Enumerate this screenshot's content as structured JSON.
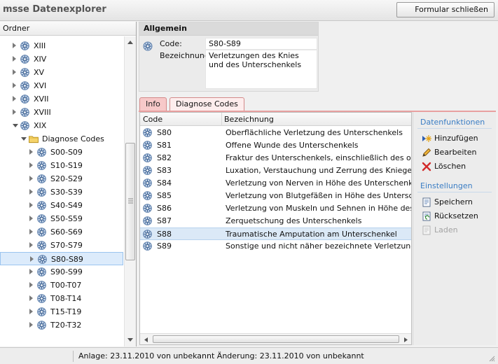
{
  "app": {
    "title": "msse Datenexplorer",
    "close_form_label": "Formular schließen"
  },
  "tree": {
    "header": "Ordner",
    "items": [
      {
        "label": "XIII",
        "level": 1,
        "expanded": false,
        "selected": false,
        "kind": "node"
      },
      {
        "label": "XIV",
        "level": 1,
        "expanded": false,
        "selected": false,
        "kind": "node"
      },
      {
        "label": "XV",
        "level": 1,
        "expanded": false,
        "selected": false,
        "kind": "node"
      },
      {
        "label": "XVI",
        "level": 1,
        "expanded": false,
        "selected": false,
        "kind": "node"
      },
      {
        "label": "XVII",
        "level": 1,
        "expanded": false,
        "selected": false,
        "kind": "node"
      },
      {
        "label": "XVIII",
        "level": 1,
        "expanded": false,
        "selected": false,
        "kind": "node"
      },
      {
        "label": "XIX",
        "level": 1,
        "expanded": true,
        "selected": false,
        "kind": "node"
      },
      {
        "label": "Diagnose Codes",
        "level": 2,
        "expanded": true,
        "selected": false,
        "kind": "folder"
      },
      {
        "label": "S00-S09",
        "level": 3,
        "expanded": false,
        "selected": false,
        "kind": "node"
      },
      {
        "label": "S10-S19",
        "level": 3,
        "expanded": false,
        "selected": false,
        "kind": "node"
      },
      {
        "label": "S20-S29",
        "level": 3,
        "expanded": false,
        "selected": false,
        "kind": "node"
      },
      {
        "label": "S30-S39",
        "level": 3,
        "expanded": false,
        "selected": false,
        "kind": "node"
      },
      {
        "label": "S40-S49",
        "level": 3,
        "expanded": false,
        "selected": false,
        "kind": "node"
      },
      {
        "label": "S50-S59",
        "level": 3,
        "expanded": false,
        "selected": false,
        "kind": "node"
      },
      {
        "label": "S60-S69",
        "level": 3,
        "expanded": false,
        "selected": false,
        "kind": "node"
      },
      {
        "label": "S70-S79",
        "level": 3,
        "expanded": false,
        "selected": false,
        "kind": "node"
      },
      {
        "label": "S80-S89",
        "level": 3,
        "expanded": false,
        "selected": true,
        "kind": "node"
      },
      {
        "label": "S90-S99",
        "level": 3,
        "expanded": false,
        "selected": false,
        "kind": "node"
      },
      {
        "label": "T00-T07",
        "level": 3,
        "expanded": false,
        "selected": false,
        "kind": "node"
      },
      {
        "label": "T08-T14",
        "level": 3,
        "expanded": false,
        "selected": false,
        "kind": "node"
      },
      {
        "label": "T15-T19",
        "level": 3,
        "expanded": false,
        "selected": false,
        "kind": "node"
      },
      {
        "label": "T20-T32",
        "level": 3,
        "expanded": false,
        "selected": false,
        "kind": "node"
      }
    ]
  },
  "general": {
    "title": "Allgemein",
    "code_label": "Code:",
    "code_value": "S80-S89",
    "desc_label": "Bezeichnung:",
    "desc_value": "Verletzungen des Knies und des Unterschenkels"
  },
  "tabs": [
    {
      "label": "Info",
      "active": false
    },
    {
      "label": "Diagnose Codes",
      "active": true
    }
  ],
  "grid": {
    "columns": [
      "Code",
      "Bezeichnung"
    ],
    "rows": [
      {
        "code": "S80",
        "desc": "Oberflächliche Verletzung des Unterschenkels",
        "selected": false
      },
      {
        "code": "S81",
        "desc": "Offene Wunde des Unterschenkels",
        "selected": false
      },
      {
        "code": "S82",
        "desc": "Fraktur des Unterschenkels, einschließlich des oberen Sprunggelenkes",
        "selected": false
      },
      {
        "code": "S83",
        "desc": "Luxation, Verstauchung und Zerrung des Kniegelenkes und von Bändern des Kniegelenkes",
        "selected": false
      },
      {
        "code": "S84",
        "desc": "Verletzung von Nerven in Höhe des Unterschenkels",
        "selected": false
      },
      {
        "code": "S85",
        "desc": "Verletzung von Blutgefäßen in Höhe des Unterschenkels",
        "selected": false
      },
      {
        "code": "S86",
        "desc": "Verletzung von Muskeln und Sehnen in Höhe des Unterschenkels",
        "selected": false
      },
      {
        "code": "S87",
        "desc": "Zerquetschung des Unterschenkels",
        "selected": false
      },
      {
        "code": "S88",
        "desc": "Traumatische Amputation am Unterschenkel",
        "selected": true
      },
      {
        "code": "S89",
        "desc": "Sonstige und nicht näher bezeichnete Verletzungen des Unterschenkels",
        "selected": false
      }
    ]
  },
  "side_panel": {
    "data_functions_title": "Datenfunktionen",
    "add_label": "Hinzufügen",
    "edit_label": "Bearbeiten",
    "delete_label": "Löschen",
    "settings_title": "Einstellungen",
    "save_label": "Speichern",
    "reset_label": "Rücksetzen",
    "load_label": "Laden"
  },
  "status": {
    "text": "Anlage: 23.11.2010 von unbekannt  Änderung: 23.11.2010 von unbekannt"
  },
  "colors": {
    "accent": "#3a7dc4",
    "tab_active": "#fdeded",
    "tab_inactive": "#f7c9c9",
    "selection": "#dcebfb"
  }
}
